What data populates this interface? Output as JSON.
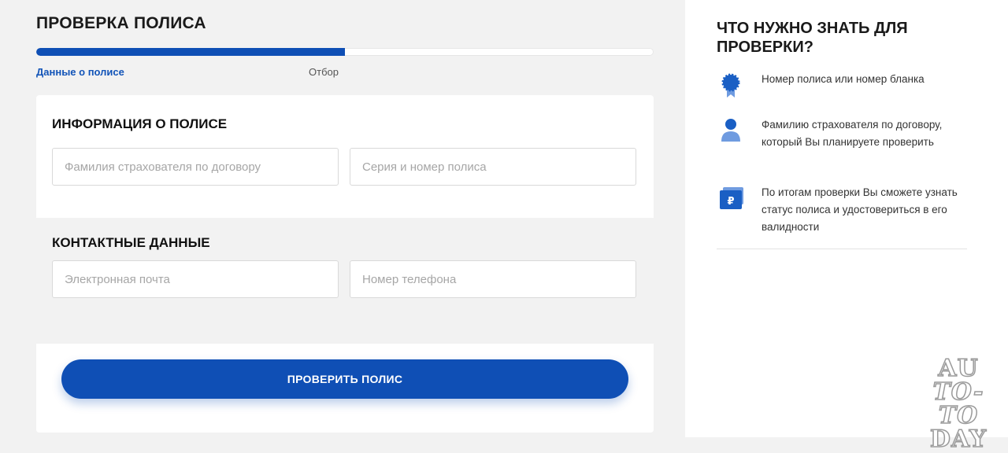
{
  "page": {
    "title": "ПРОВЕРКА ПОЛИСА"
  },
  "progress": {
    "value_percent": 50,
    "current_step": "Данные о полисе",
    "next_step": "Отбор",
    "fill_color": "#0f4fb5"
  },
  "form": {
    "info_section_title": "ИНФОРМАЦИЯ О ПОЛИСЕ",
    "surname_placeholder": "Фамилия страхователя по договору",
    "surname_value": "",
    "policy_placeholder": "Серия и номер полиса",
    "policy_value": "",
    "contact_section_title": "КОНТАКТНЫЕ ДАННЫЕ",
    "email_placeholder": "Электронная почта",
    "email_value": "",
    "phone_placeholder": "Номер телефона",
    "phone_value": "",
    "submit_label": "ПРОВЕРИТЬ ПОЛИС"
  },
  "sidebar": {
    "title": "ЧТО НУЖНО ЗНАТЬ ДЛЯ ПРОВЕРКИ?",
    "tips": [
      {
        "icon": "badge-icon",
        "text": "Номер полиса или номер бланка"
      },
      {
        "icon": "person-icon",
        "text": "Фамилию страхователя по договору, который Вы планируете проверить"
      },
      {
        "icon": "ruble-wallet-icon",
        "text": "По итогам проверки Вы сможете узнать статус полиса и удостовериться в его валидности"
      }
    ]
  },
  "watermark": {
    "line1": "AU",
    "line2": "TO-TO",
    "line3": "DAY"
  },
  "colors": {
    "accent": "#0f4fb5",
    "icon_blue": "#1a5fc4"
  }
}
